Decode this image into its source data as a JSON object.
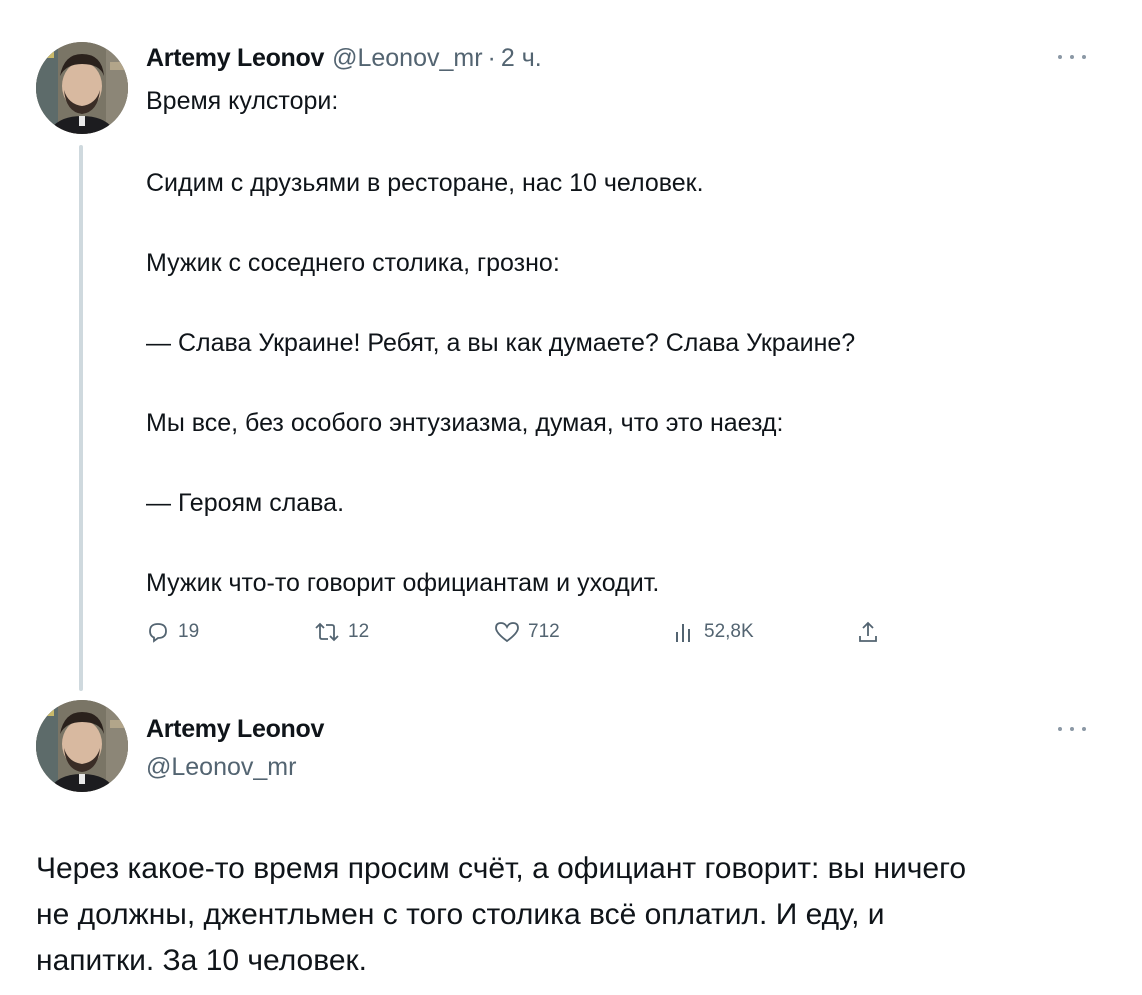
{
  "tweet1": {
    "author_name": "Artemy Leonov",
    "author_handle": "@Leonov_mr",
    "separator": "·",
    "time": "2 ч.",
    "lines": [
      "Время кулстори:",
      "Сидим с друзьями в ресторане, нас 10 человек.",
      "Мужик с соседнего столика, грозно:",
      "— Слава Украине! Ребят, а вы как думаете? Слава Украине?",
      "Мы все, без особого энтузиазма, думая, что это наезд:",
      "— Героям слава.",
      "Мужик что-то говорит официантам и уходит."
    ],
    "actions": {
      "replies": "19",
      "retweets": "12",
      "likes": "712",
      "views": "52,8K"
    }
  },
  "tweet2": {
    "author_name": "Artemy Leonov",
    "author_handle": "@Leonov_mr",
    "lines": [
      "Через какое-то время просим счёт, а официант говорит: вы ничего",
      "не должны, джентльмен с того столика всё оплатил. И еду, и",
      "напитки. За 10 человек."
    ]
  },
  "icons": {
    "reply": "reply-icon",
    "retweet": "retweet-icon",
    "like": "heart-icon",
    "views": "analytics-icon",
    "share": "share-icon",
    "more": "more-icon"
  },
  "colors": {
    "text": "#0f1419",
    "secondary": "#536471",
    "thread_line": "#cfd9de"
  }
}
